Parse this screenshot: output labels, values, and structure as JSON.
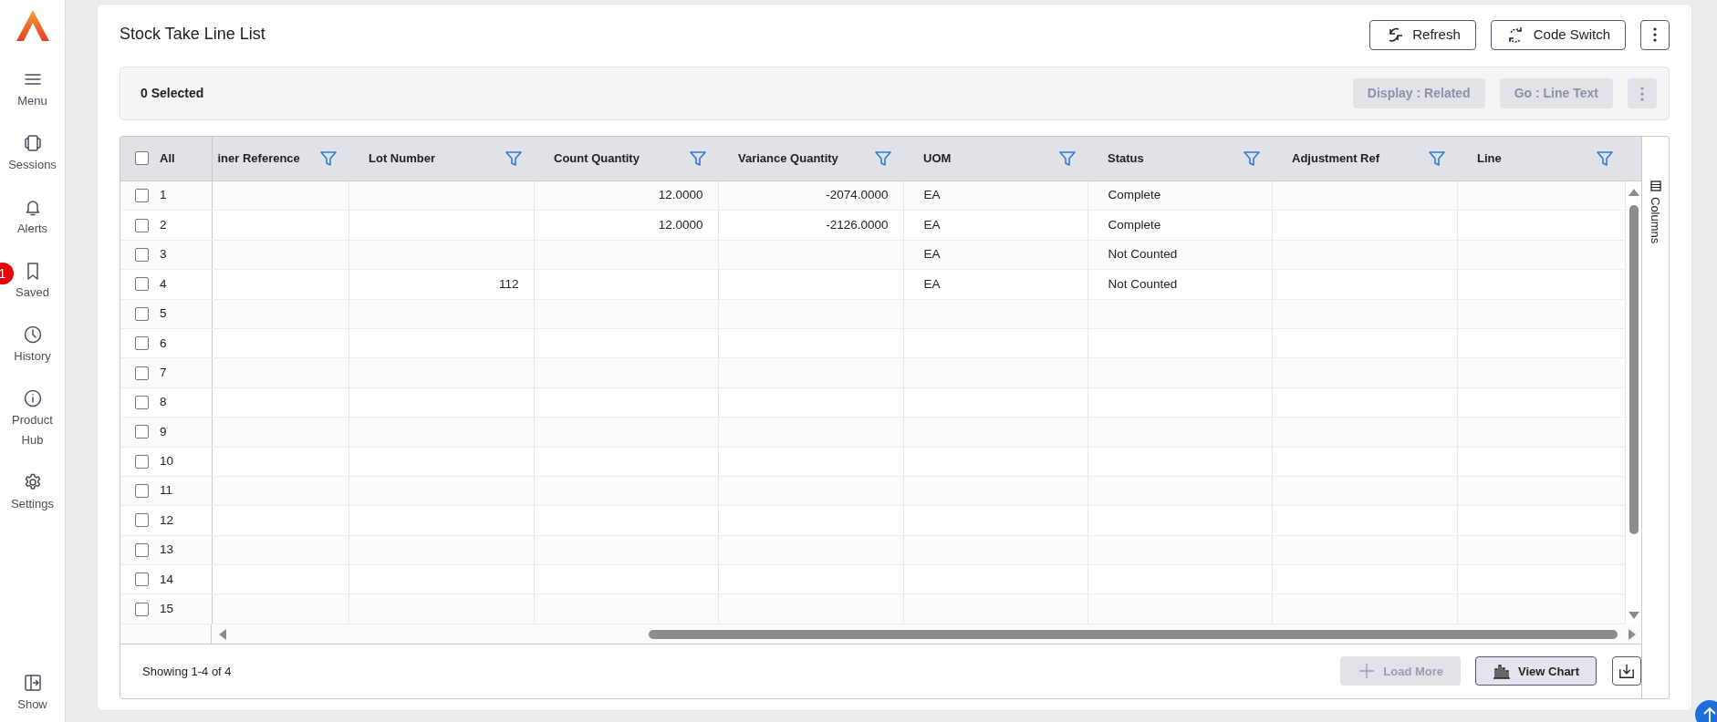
{
  "sidebar": {
    "items": [
      {
        "label": "Menu"
      },
      {
        "label": "Sessions"
      },
      {
        "label": "Alerts"
      },
      {
        "label": "Saved",
        "badge": "1"
      },
      {
        "label": "History"
      },
      {
        "label": "Product Hub"
      },
      {
        "label": "Settings"
      }
    ],
    "bottom_item": {
      "label": "Show"
    }
  },
  "page": {
    "title": "Stock Take Line List",
    "buttons": [
      {
        "label": "Refresh"
      },
      {
        "label": "Code Switch"
      }
    ]
  },
  "toolbar": {
    "selected_count": "0 Selected",
    "actions": [
      {
        "label": "Display : Related",
        "disabled": true
      },
      {
        "label": "Go : Line Text",
        "disabled": true
      }
    ],
    "more_disabled": true
  },
  "table": {
    "select_all": {
      "label": "All",
      "selected": false
    },
    "columns": [
      {
        "label": "iner Reference"
      },
      {
        "label": "Lot Number"
      },
      {
        "label": "Count Quantity"
      },
      {
        "label": "Variance Quantity"
      },
      {
        "label": "UOM"
      },
      {
        "label": "Status"
      },
      {
        "label": "Adjustment Ref"
      },
      {
        "label": "Line"
      }
    ],
    "rows": [
      {
        "number": "1",
        "selected": false,
        "cells": [
          null,
          null,
          "12.0000",
          "-2074.0000",
          "EA",
          "Complete",
          null,
          null
        ]
      },
      {
        "number": "2",
        "selected": false,
        "cells": [
          null,
          null,
          "12.0000",
          "-2126.0000",
          "EA",
          "Complete",
          null,
          null
        ]
      },
      {
        "number": "3",
        "selected": false,
        "cells": [
          null,
          null,
          null,
          null,
          "EA",
          "Not Counted",
          null,
          null
        ]
      },
      {
        "number": "4",
        "selected": false,
        "cells": [
          null,
          "112",
          null,
          null,
          "EA",
          "Not Counted",
          null,
          null
        ]
      },
      {
        "number": "5",
        "selected": false,
        "cells": [
          null,
          null,
          null,
          null,
          null,
          null,
          null,
          null
        ]
      },
      {
        "number": "6",
        "selected": false,
        "cells": [
          null,
          null,
          null,
          null,
          null,
          null,
          null,
          null
        ]
      },
      {
        "number": "7",
        "selected": false,
        "cells": [
          null,
          null,
          null,
          null,
          null,
          null,
          null,
          null
        ]
      },
      {
        "number": "8",
        "selected": false,
        "cells": [
          null,
          null,
          null,
          null,
          null,
          null,
          null,
          null
        ]
      },
      {
        "number": "9",
        "selected": false,
        "cells": [
          null,
          null,
          null,
          null,
          null,
          null,
          null,
          null
        ]
      },
      {
        "number": "10",
        "selected": false,
        "cells": [
          null,
          null,
          null,
          null,
          null,
          null,
          null,
          null
        ]
      },
      {
        "number": "11",
        "selected": false,
        "cells": [
          null,
          null,
          null,
          null,
          null,
          null,
          null,
          null
        ]
      },
      {
        "number": "12",
        "selected": false,
        "cells": [
          null,
          null,
          null,
          null,
          null,
          null,
          null,
          null
        ]
      },
      {
        "number": "13",
        "selected": false,
        "cells": [
          null,
          null,
          null,
          null,
          null,
          null,
          null,
          null
        ]
      },
      {
        "number": "14",
        "selected": false,
        "cells": [
          null,
          null,
          null,
          null,
          null,
          null,
          null,
          null
        ]
      },
      {
        "number": "15",
        "selected": false,
        "cells": [
          null,
          null,
          null,
          null,
          null,
          null,
          null,
          null
        ]
      }
    ],
    "side_panel": "Columns"
  },
  "footer": {
    "summary": "Showing 1-4 of 4",
    "load_more": {
      "label": "Load More",
      "disabled": true
    },
    "view_chart": {
      "label": "View Chart"
    }
  }
}
